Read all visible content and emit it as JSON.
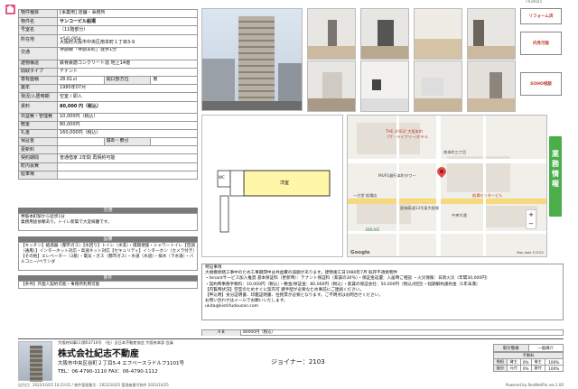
{
  "header": {
    "code": "F030025"
  },
  "spec": {
    "category_label": "物件種目",
    "category_value": "[事業用] 店舗・事務所",
    "name_label": "物件名",
    "name_value": "サンコーピル船場",
    "room_label": "号室名",
    "room_value": "（11階部分）",
    "address_label": "所在地",
    "postcode": "〒541-0054",
    "address_value": "大阪府大阪市中央区南本町１丁目3-9",
    "traffic_label": "交通",
    "traffic_value": "堺筋線「堺筋本町」徒歩1分",
    "structure_label": "建物構造",
    "structure_value": "鉄骨鉄筋コンクリート造 地上14階",
    "layout_label": "間取タイプ",
    "layout_value": "テナント",
    "area_label": "専有面積",
    "area_value": "28.61㎡",
    "balcony_label": "間口部方位",
    "balcony_value": "南",
    "built_label": "築年",
    "built_value": "1980年07月",
    "status_label": "現況/入居時期",
    "status_value": "空室 / 即入",
    "rent_label": "賃料",
    "rent_value": "80,000 円（税込）",
    "common_label": "共益費・管理費",
    "common_value": "10,000円（税込）",
    "deposit_label": "敷金",
    "deposit_value": "80,000円",
    "key_label": "礼金",
    "key_value": "160,000円（税込）",
    "guarantee_label": "保証金",
    "guarantee_value": "",
    "amort_label": "償却・敷引",
    "amort_value": "",
    "renew_label": "更新料",
    "renew_value": "",
    "contract_label": "契約期間",
    "contract_value": "普通借家 2年間 再契約可能",
    "town_label": "町内会費",
    "town_value": "",
    "parking_label": "駐車場",
    "parking_value": ""
  },
  "traffic_section": {
    "title": "交通",
    "lines": [
      "堺筋本町駅から徒歩1分",
      "業務用途依頼あり。トイレ新築で大変綺麗です。"
    ]
  },
  "equipment_section": {
    "title": "設備",
    "text": "【キッチン】給湯器（都市ガス）【水回り】トイレ（水洗）・揚揚便座・シャワートイレ【空調（通風）】インターネット対応・高速ネット対応【セキュリティ】インターホン（カメラ付き）【その他】エレベーター（3基）・電気・ガス（都市ガス）・水道（水道）・排水（下水道）・バルコニー/ベランダ"
  },
  "conditions_section": {
    "title": "条件",
    "text": "【条件】外国人契約可能・事務所利用可能"
  },
  "badges": {
    "reform": "リフォーム済",
    "layout": "内見可能",
    "soho": "SOHO相談"
  },
  "floorplan": {
    "room_label": "洋室",
    "room2": "WC"
  },
  "map": {
    "labels": [
      "THE LIVELY 大阪本町",
      "(ザ・ライブリー)ホテル",
      "南本町三丁目",
      "MUFG銀行本町タワー",
      "一方堂 船場店",
      "船場センタービル",
      "中央大通",
      "阪神高速13号東大阪線",
      "BOLIVE",
      "Google",
      "Map data ©2022"
    ]
  },
  "remarks": {
    "lines": [
      "特記事項",
      "大規模修繕工事中のため工事期間中は共益費の減額があります。建物竣工日1980年7月 既存不適格物件",
      "・tenantサービス加入推奨 基本保証料（更新時）：テナント保証料（家賃の30％）・保証金返還：入居時ご相談 ・火災保険：日新火災（年間30,000円）",
      "・契約時事務手数料：10,000円（税込）・敷金/保証金：80,000円（税込）・家賃の保証会社：50,000円（税込/初回）・短期解約違約金（1年未満）",
      "【内覧時状況】空室のためすぐに案内可 鍵手配が必要なため事前にご連絡ください。",
      "【申込時】身分証明書、印鑑証明書、住民票が必要となります。ご不明点はお問合せください。",
      "お問い合わせはメールでお願いいたします。",
      "ukita@kishifudousan.com"
    ]
  },
  "areabar": {
    "label": "A B",
    "value": "80000円（税込）"
  },
  "company": {
    "top": "大阪府知事(1)第63710号 （社）全日本不動産協会 大阪府本部 会員",
    "name": "株式会社紀志不動産",
    "address": "大阪市中央区谷町２丁目5-4 エフベースラドルフ1101号",
    "tel": "TEL：06-4790-1110  FAX：06-4790-1112",
    "staff": "ジョイナー：2103"
  },
  "deal": {
    "type_label": "取引態様",
    "type_value": "一般媒介",
    "fee_header": "手数料",
    "rows": [
      {
        "k": "負担",
        "a": "貸主",
        "p1": "0%",
        "b": "借主",
        "p2": "100%"
      },
      {
        "k": "配分",
        "a": "元付",
        "p1": "0%",
        "b": "客付",
        "p2": "100%"
      }
    ]
  },
  "footer": {
    "left": "出力日：2022/10/25 10:23:01 / 物件管理番号：2022/10/25 管理者番号物件 2022/10/25",
    "right": "Powered by RealNetPro ver.1.00"
  }
}
